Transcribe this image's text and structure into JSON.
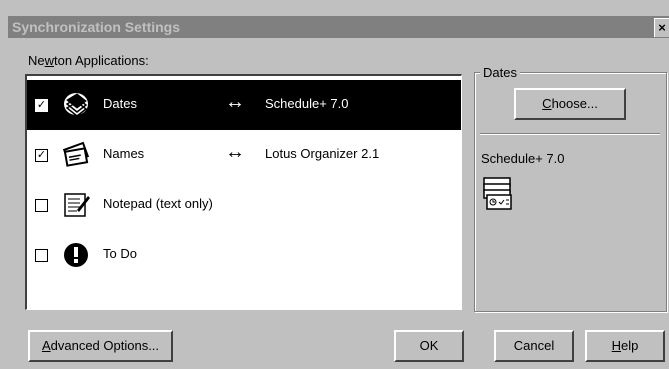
{
  "window": {
    "title": "Synchronization Settings",
    "close": "×"
  },
  "apps": {
    "label_prefix": "Ne",
    "label_accel": "w",
    "label_suffix": "ton Applications:",
    "items": [
      {
        "name": "Dates",
        "checked": true,
        "selected": true,
        "arrow": "↔",
        "target": "Schedule+ 7.0",
        "icon": "calendar-stack-icon"
      },
      {
        "name": "Names",
        "checked": true,
        "selected": false,
        "arrow": "↔",
        "target": "Lotus Organizer 2.1",
        "icon": "cards-icon"
      },
      {
        "name": "Notepad (text only)",
        "checked": false,
        "selected": false,
        "arrow": "",
        "target": "",
        "icon": "notepad-icon"
      },
      {
        "name": "To Do",
        "checked": false,
        "selected": false,
        "arrow": "",
        "target": "",
        "icon": "exclamation-icon"
      }
    ]
  },
  "dates_group": {
    "legend": "Dates",
    "choose_accel": "C",
    "choose_rest": "hoose...",
    "app_name": "Schedule+ 7.0",
    "icon": "schedule-plus-icon"
  },
  "buttons": {
    "advanced_accel": "A",
    "advanced_rest": "dvanced Options...",
    "ok": "OK",
    "cancel": "Cancel",
    "help_accel": "H",
    "help_rest": "elp"
  },
  "check_mark": "☑"
}
